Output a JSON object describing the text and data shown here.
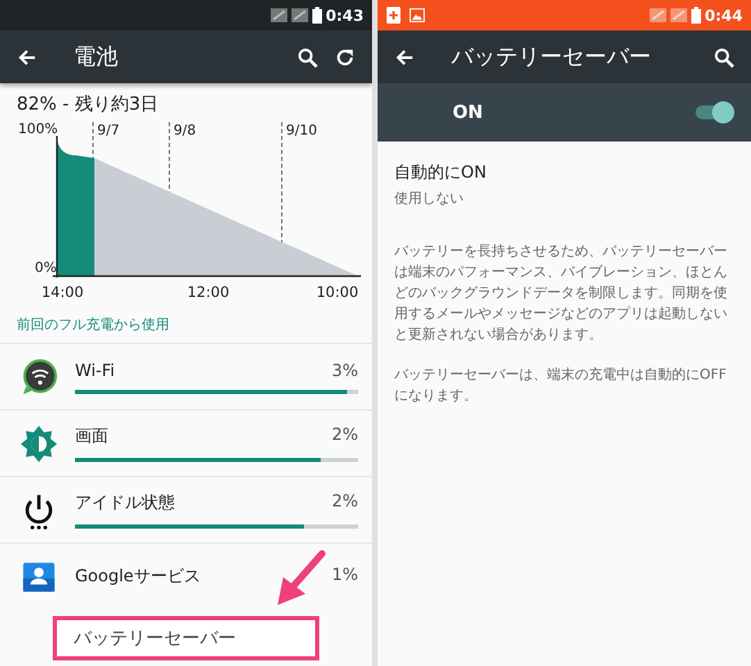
{
  "battery_screen": {
    "status_bar": {
      "time": "0:43"
    },
    "toolbar": {
      "title": "電池"
    },
    "summary": "82% - 残り約3日",
    "chart": {
      "y_labels": [
        "100%",
        "0%"
      ],
      "date_labels": [
        "9/7",
        "9/8",
        "9/10"
      ],
      "time_labels": [
        "14:00",
        "12:00",
        "10:00"
      ]
    },
    "section_header": "前回のフル充電から使用",
    "usage_items": [
      {
        "kind": "wifi",
        "name": "Wi-Fi",
        "percent": "3%",
        "level": 0.96
      },
      {
        "kind": "screen",
        "name": "画面",
        "percent": "2%",
        "level": 0.87
      },
      {
        "kind": "idle",
        "name": "アイドル状態",
        "percent": "2%",
        "level": 0.81
      },
      {
        "kind": "google",
        "name": "Googleサービス",
        "percent": "1%"
      }
    ],
    "callout": "バッテリーセーバー"
  },
  "saver_screen": {
    "status_bar": {
      "time": "0:44"
    },
    "toolbar": {
      "title": "バッテリーセーバー"
    },
    "master_switch": {
      "label": "ON",
      "on": true
    },
    "auto_on": {
      "title": "自動的にON",
      "summary": "使用しない"
    },
    "paragraphs": [
      "バッテリーを長持ちさせるため、バッテリーセーバーは端末のパフォーマンス、バイブレーション、ほとんどのバックグラウンドデータを制限します。同期を使用するメールやメッセージなどのアプリは起動しないと更新されない場合があります。",
      "バッテリーセーバーは、端末の充電中は自動的にOFFになります。"
    ]
  }
}
